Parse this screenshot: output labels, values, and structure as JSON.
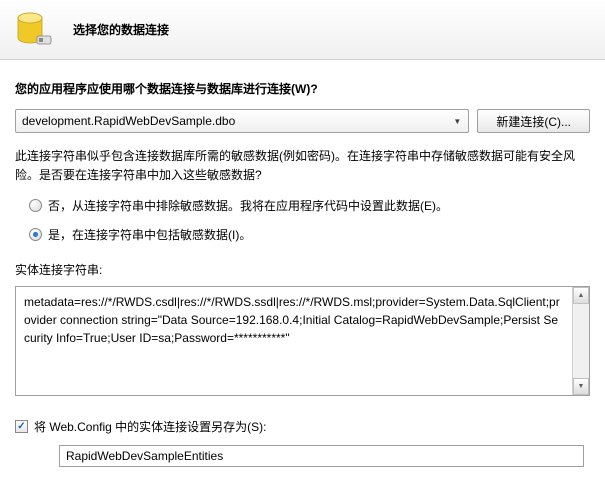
{
  "header": {
    "title": "选择您的数据连接"
  },
  "question": "您的应用程序应使用哪个数据连接与数据库进行连接(W)?",
  "connection": {
    "selected": "development.RapidWebDevSample.dbo",
    "new_button": "新建连接(C)..."
  },
  "warning": "此连接字符串似乎包含连接数据库所需的敏感数据(例如密码)。在连接字符串中存储敏感数据可能有安全风险。是否要在连接字符串中加入这些敏感数据?",
  "radio": {
    "exclude": "否，从连接字符串中排除敏感数据。我将在应用程序代码中设置此数据(E)。",
    "include": "是，在连接字符串中包括敏感数据(I)。"
  },
  "connstr": {
    "label": "实体连接字符串:",
    "value": "metadata=res://*/RWDS.csdl|res://*/RWDS.ssdl|res://*/RWDS.msl;provider=System.Data.SqlClient;provider connection string=\"Data Source=192.168.0.4;Initial Catalog=RapidWebDevSample;Persist Security Info=True;User ID=sa;Password=***********\""
  },
  "save": {
    "label": "将 Web.Config 中的实体连接设置另存为(S):",
    "value": "RapidWebDevSampleEntities"
  }
}
